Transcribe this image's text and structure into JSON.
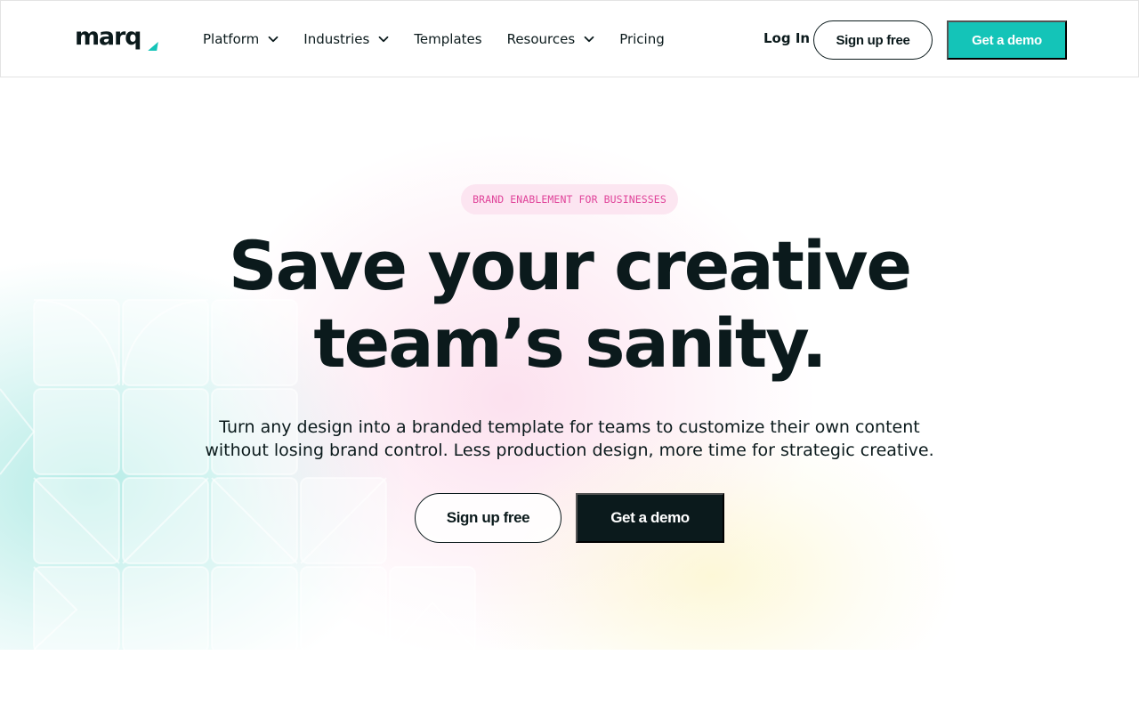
{
  "header": {
    "logo_text": "marq",
    "nav": [
      {
        "label": "Platform",
        "has_dropdown": true
      },
      {
        "label": "Industries",
        "has_dropdown": true
      },
      {
        "label": "Templates",
        "has_dropdown": false
      },
      {
        "label": "Resources",
        "has_dropdown": true
      },
      {
        "label": "Pricing",
        "has_dropdown": false
      }
    ],
    "login_label": "Log In",
    "signup_label": "Sign up free",
    "demo_label": "Get a demo"
  },
  "hero": {
    "badge": "BRAND ENABLEMENT FOR BUSINESSES",
    "headline_line1": "Save your creative",
    "headline_line2": "team’s sanity.",
    "subhead_line1": "Turn any design into a branded template for teams to customize their own content",
    "subhead_line2": "without losing brand control. Less production design, more time for strategic creative.",
    "signup_label": "Sign up free",
    "demo_label": "Get a demo"
  },
  "colors": {
    "accent_teal": "#14c4b8",
    "text_dark": "#0b1a1c",
    "badge_pink": "#e0449a",
    "badge_bg": "#fce2ee"
  },
  "icons": {
    "logo": "marq-logo",
    "dropdown": "chevron-down-icon"
  }
}
